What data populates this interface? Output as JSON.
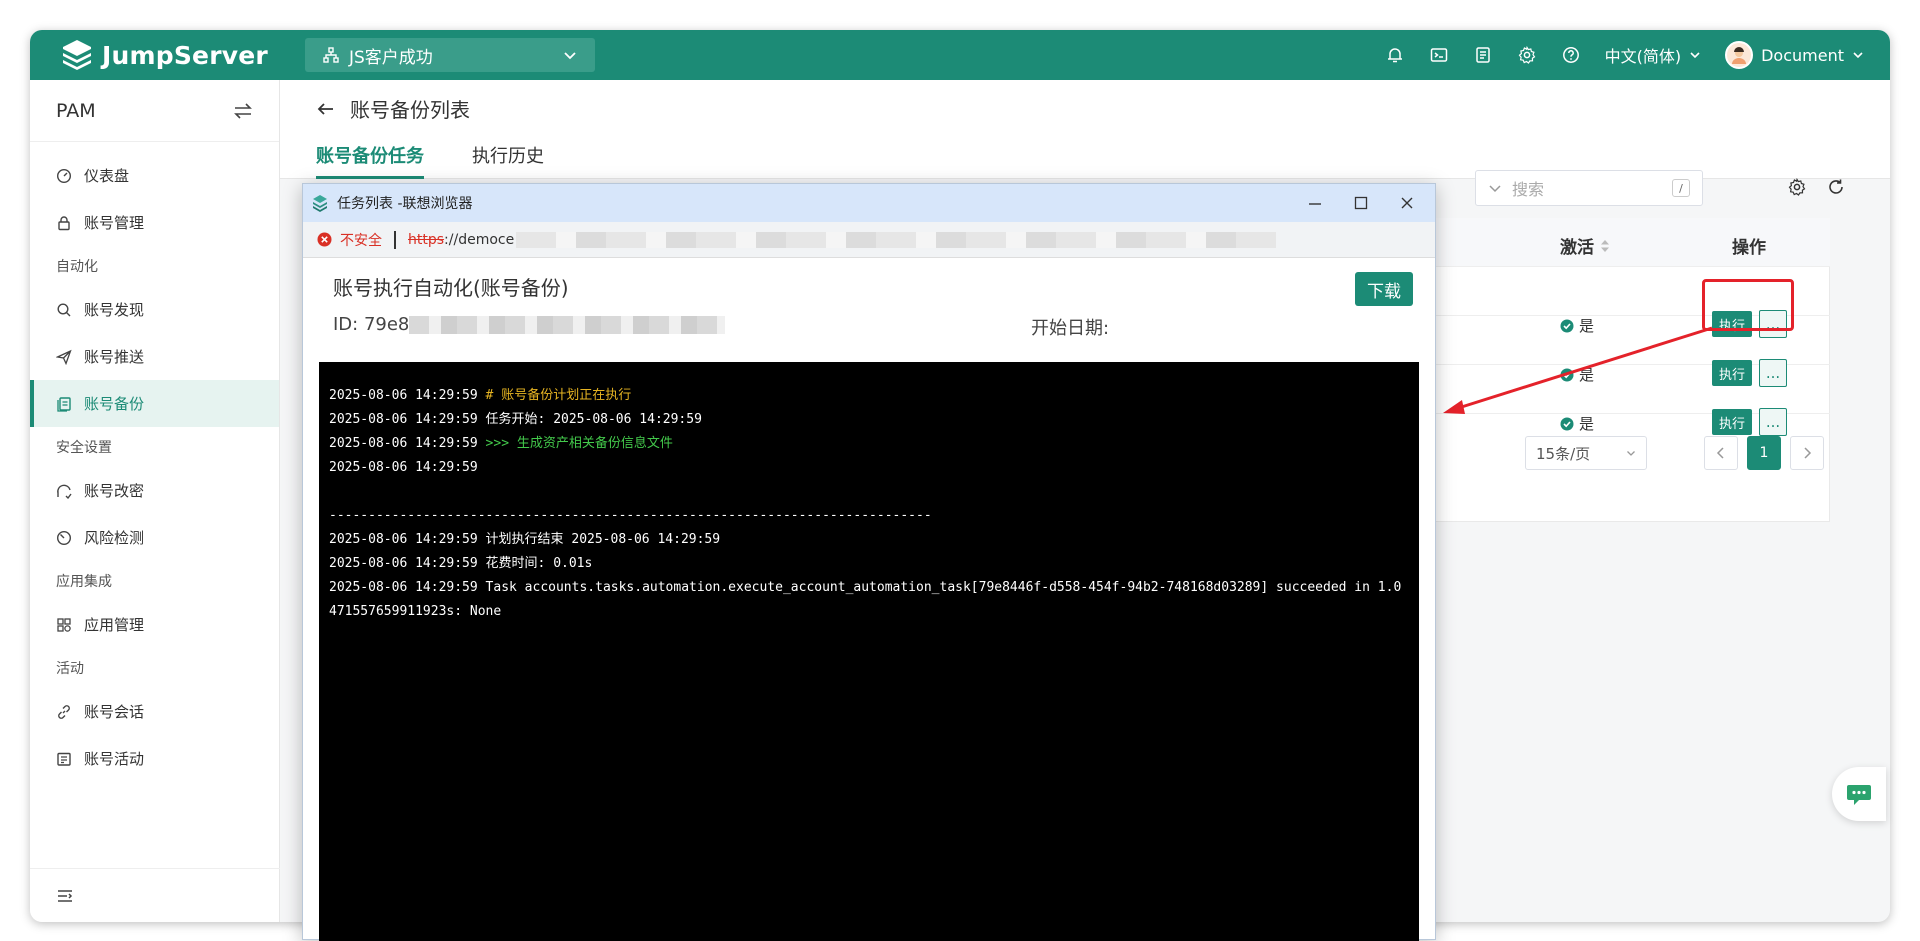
{
  "header": {
    "logo_text": "JumpServer",
    "org_name": "JS客户成功",
    "language": "中文(简体)",
    "user_name": "Document",
    "icons": [
      "bell-icon",
      "terminal-icon",
      "notepad-icon",
      "gear-icon",
      "help-icon"
    ]
  },
  "sidebar": {
    "title": "PAM",
    "items": [
      {
        "label": "仪表盘",
        "icon": "dashboard-icon"
      },
      {
        "label": "账号管理",
        "icon": "lock-icon"
      }
    ],
    "groups": [
      {
        "title": "自动化",
        "items": [
          {
            "label": "账号发现",
            "icon": "search-icon"
          },
          {
            "label": "账号推送",
            "icon": "send-icon"
          },
          {
            "label": "账号备份",
            "icon": "backup-icon",
            "active": true
          }
        ]
      },
      {
        "title": "安全设置",
        "items": [
          {
            "label": "账号改密",
            "icon": "key-change-icon"
          },
          {
            "label": "风险检测",
            "icon": "risk-icon"
          }
        ]
      },
      {
        "title": "应用集成",
        "items": [
          {
            "label": "应用管理",
            "icon": "apps-icon"
          }
        ]
      },
      {
        "title": "活动",
        "items": [
          {
            "label": "账号会话",
            "icon": "link-icon"
          },
          {
            "label": "账号活动",
            "icon": "activity-icon"
          }
        ]
      }
    ]
  },
  "page": {
    "title": "账号备份列表",
    "tabs": [
      {
        "label": "账号备份任务",
        "active": true
      },
      {
        "label": "执行历史",
        "active": false
      }
    ],
    "search_placeholder": "搜索",
    "search_shortcut": "/",
    "table": {
      "columns": [
        "激活",
        "操作"
      ],
      "rows": [
        {
          "active": "是",
          "exec_label": "执行",
          "more_label": "..."
        },
        {
          "active": "是",
          "exec_label": "执行",
          "more_label": "..."
        },
        {
          "active": "是",
          "exec_label": "执行",
          "more_label": "..."
        }
      ]
    },
    "pagination": {
      "page_size": "15条/页",
      "current_page": "1"
    }
  },
  "popup": {
    "window_title": "任务列表 -联想浏览器",
    "insecure_label": "不安全",
    "url_scheme": "https",
    "url_host_visible": "://democe",
    "job_title": "账号执行自动化(账号备份)",
    "download_label": "下载",
    "id_label": "ID: 79e8",
    "start_date_label": "开始日期:",
    "terminal_lines": [
      {
        "ts": "2025-08-06 14:29:59",
        "text": " # 账号备份计划正在执行",
        "color": "yellow"
      },
      {
        "ts": "2025-08-06 14:29:59",
        "text": " 任务开始: 2025-08-06 14:29:59",
        "color": "white"
      },
      {
        "ts": "2025-08-06 14:29:59",
        "text": " >>> 生成资产相关备份信息文件",
        "color": "green"
      },
      {
        "ts": "2025-08-06 14:29:59",
        "text": "",
        "color": "white"
      },
      {
        "ts": "",
        "text": "",
        "color": "white"
      },
      {
        "ts": "",
        "text": "-----------------------------------------------------------------------------",
        "color": "white"
      },
      {
        "ts": "2025-08-06 14:29:59",
        "text": " 计划执行结束 2025-08-06 14:29:59",
        "color": "white"
      },
      {
        "ts": "2025-08-06 14:29:59",
        "text": " 花费时间: 0.01s",
        "color": "white"
      },
      {
        "ts": "2025-08-06 14:29:59",
        "text": " Task accounts.tasks.automation.execute_account_automation_task[79e8446f-d558-454f-94b2-748168d03289] succeeded in 1.0471557659911923s: None",
        "color": "white"
      }
    ]
  },
  "colors": {
    "brand": "#1c8b76",
    "annotation": "#e4222a"
  }
}
